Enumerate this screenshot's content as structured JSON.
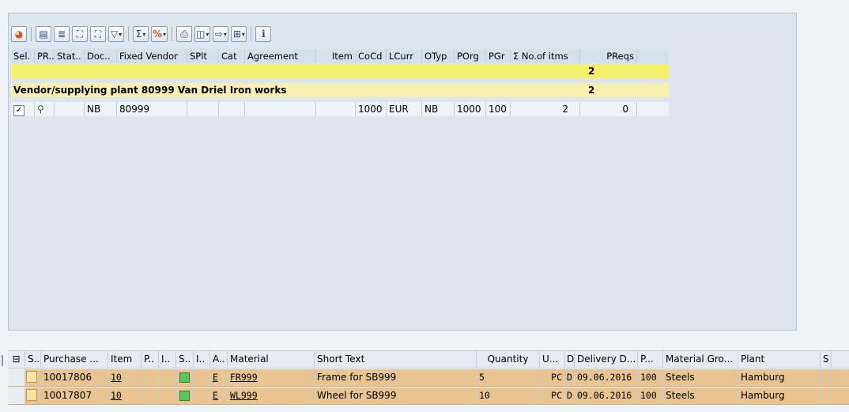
{
  "toolbar": {
    "buttons": [
      {
        "name": "refresh-icon",
        "glyph": "◕"
      },
      {
        "name": "details-icon",
        "glyph": "▤"
      },
      {
        "name": "filter-sort-icon",
        "glyph": "≣"
      },
      {
        "name": "find-icon",
        "glyph": "⛶"
      },
      {
        "name": "find-next-icon",
        "glyph": "⛶"
      },
      {
        "name": "filter-icon",
        "glyph": "▽"
      },
      {
        "name": "sum-icon",
        "glyph": "Σ"
      },
      {
        "name": "subtotal-icon",
        "glyph": "%"
      },
      {
        "name": "print-icon",
        "glyph": "⎙"
      },
      {
        "name": "view-icon",
        "glyph": "◫"
      },
      {
        "name": "export-icon",
        "glyph": "⇨"
      },
      {
        "name": "layout-icon",
        "glyph": "⊞"
      },
      {
        "name": "info-icon",
        "glyph": "i"
      }
    ]
  },
  "upper": {
    "columns": [
      "Sel.",
      "PR..",
      "Stat..",
      "Doc..",
      "Fixed Vendor",
      "SPlt",
      "Cat",
      "Agreement",
      "Item",
      "CoCd",
      "LCurr",
      "OTyp",
      "POrg",
      "PGr",
      "Σ No.of itms",
      "PReqs"
    ],
    "total1": {
      "count": "2"
    },
    "total2": {
      "label": "Vendor/supplying plant 80999 Van Driel Iron works",
      "count": "2"
    },
    "row": {
      "sel": "✓",
      "pr": "⚲",
      "stat": "",
      "doc": "NB",
      "vendor": "80999",
      "splt": "",
      "cat": "",
      "agreement": "",
      "item": "",
      "cocd": "1000",
      "lcurr": "EUR",
      "otyp": "NB",
      "porg": "1000",
      "pgr": "100",
      "items": "2",
      "preqs": "0"
    }
  },
  "lower": {
    "columns": [
      "S..",
      "Purchase ...",
      "Item",
      "P..",
      "I..",
      "S..",
      "I..",
      "A..",
      "Material",
      "Short Text",
      "Quantity",
      "U...",
      "D",
      "Delivery D...",
      "P...",
      "Material Gro...",
      "Plant",
      "S"
    ],
    "rows": [
      {
        "pr": "10017806",
        "item": "10",
        "a": "E",
        "material": "FR999",
        "text": "Frame for SB999",
        "qty": "5",
        "unit": "PC",
        "d": "D",
        "date": "09.06.2016",
        "p": "100",
        "group": "Steels",
        "plant": "Hamburg"
      },
      {
        "pr": "10017807",
        "item": "10",
        "a": "E",
        "material": "WL999",
        "text": "Wheel for SB999",
        "qty": "10",
        "unit": "PC",
        "d": "D",
        "date": "09.06.2016",
        "p": "100",
        "group": "Steels",
        "plant": "Hamburg"
      }
    ]
  }
}
